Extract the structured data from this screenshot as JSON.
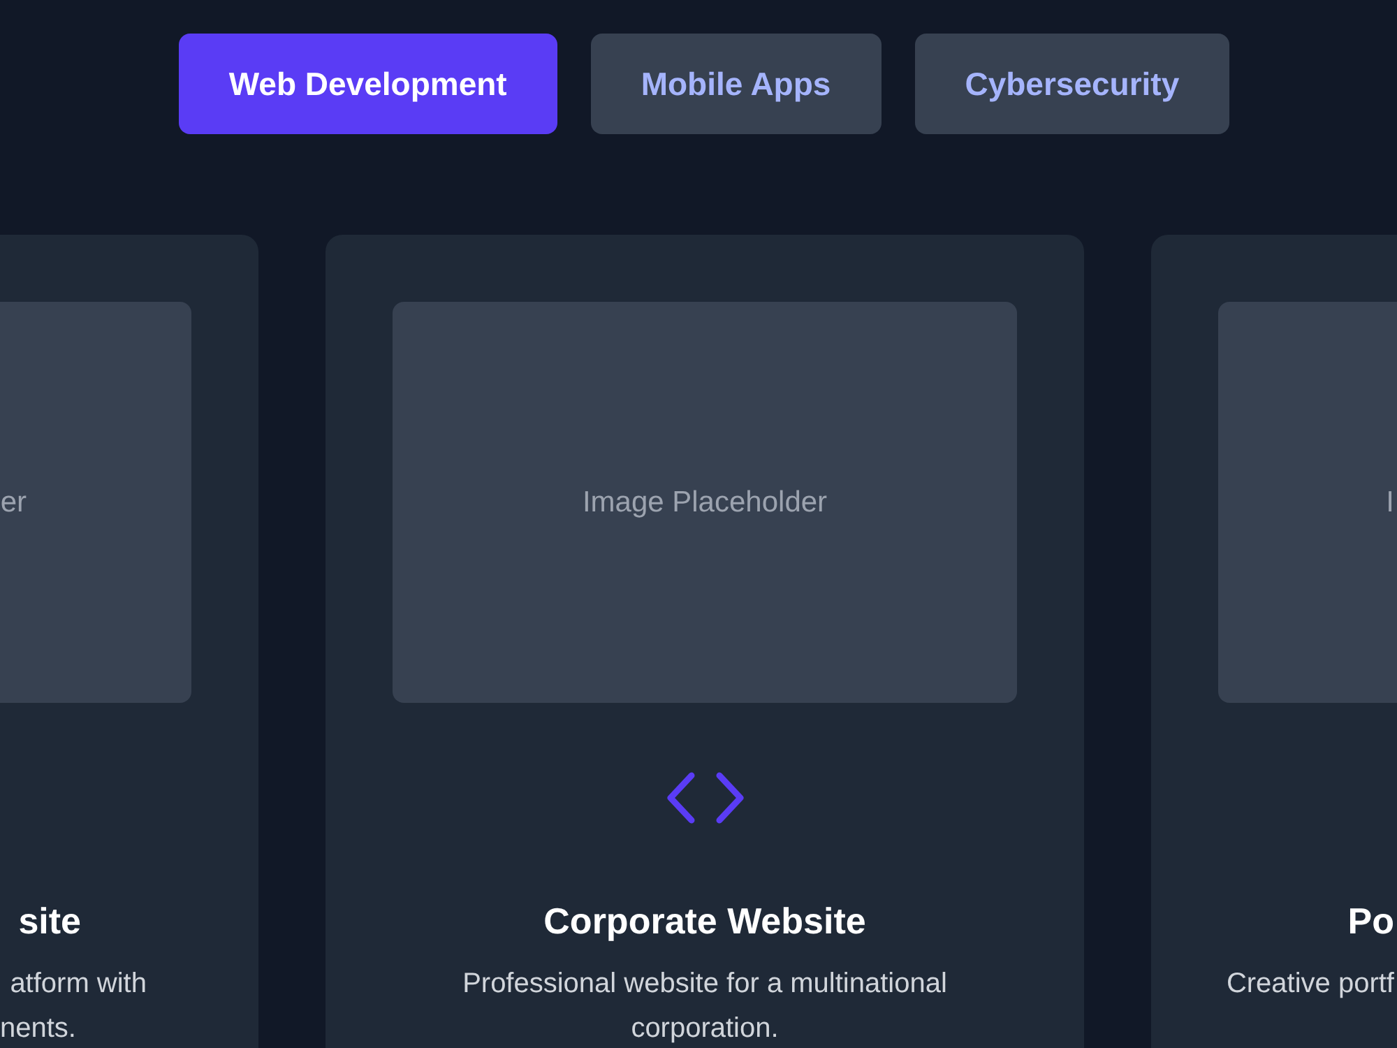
{
  "tabs": [
    {
      "label": "Web Development",
      "selected": true
    },
    {
      "label": "Mobile Apps",
      "selected": false
    },
    {
      "label": "Cybersecurity",
      "selected": false
    }
  ],
  "cards": [
    {
      "kind": "left-clipped",
      "placeholder": "er",
      "title": "site",
      "description": [
        "atform with",
        "nents."
      ]
    },
    {
      "kind": "full",
      "placeholder": "Image Placeholder",
      "title": "Corporate Website",
      "description": [
        "Professional website for a multinational",
        "corporation."
      ]
    },
    {
      "kind": "right-clipped",
      "placeholder": "I",
      "title": "Po",
      "description": [
        "Creative portf"
      ]
    }
  ]
}
